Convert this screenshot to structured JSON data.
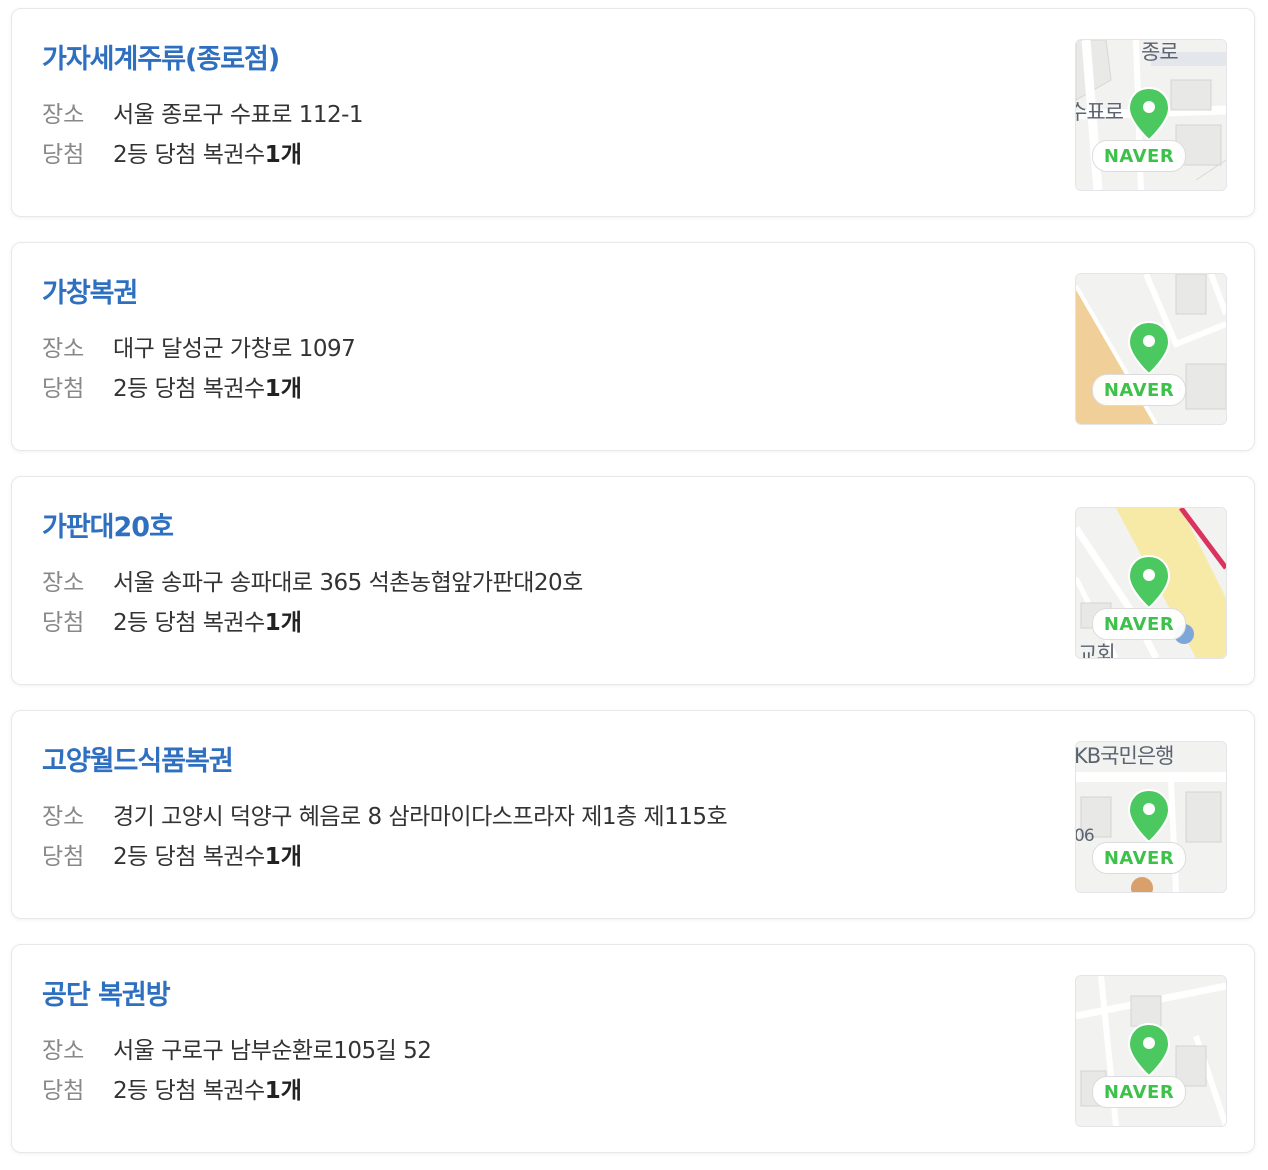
{
  "labels": {
    "address": "장소",
    "win": "당첨"
  },
  "map_logo": "NAVER",
  "colors": {
    "title": "#2f6fc0",
    "pin": "#4cc860",
    "logo": "#3ec14a"
  },
  "stores": [
    {
      "name": "가자세계주류(종로점)",
      "address": "서울 종로구 수표로 112-1",
      "win_text": "2등 당첨 복권수 ",
      "win_count": "1개",
      "map_labels": [
        "종로",
        "수표로"
      ]
    },
    {
      "name": "가창복권",
      "address": "대구 달성군 가창로 1097",
      "win_text": "2등 당첨 복권수 ",
      "win_count": "1개",
      "map_labels": []
    },
    {
      "name": "가판대20호",
      "address": "서울 송파구 송파대로 365 석촌농협앞가판대20호",
      "win_text": "2등 당첨 복권수 ",
      "win_count": "1개",
      "map_labels": [
        "교회"
      ]
    },
    {
      "name": "고양월드식품복권",
      "address": "경기 고양시 덕양구 혜음로 8 삼라마이다스프라자 제1층 제115호",
      "win_text": "2등 당첨 복권수 ",
      "win_count": "1개",
      "map_labels": [
        "KB국민은행",
        "06"
      ]
    },
    {
      "name": "공단 복권방",
      "address": "서울 구로구 남부순환로105길 52",
      "win_text": "2등 당첨 복권수 ",
      "win_count": "1개",
      "map_labels": []
    }
  ]
}
